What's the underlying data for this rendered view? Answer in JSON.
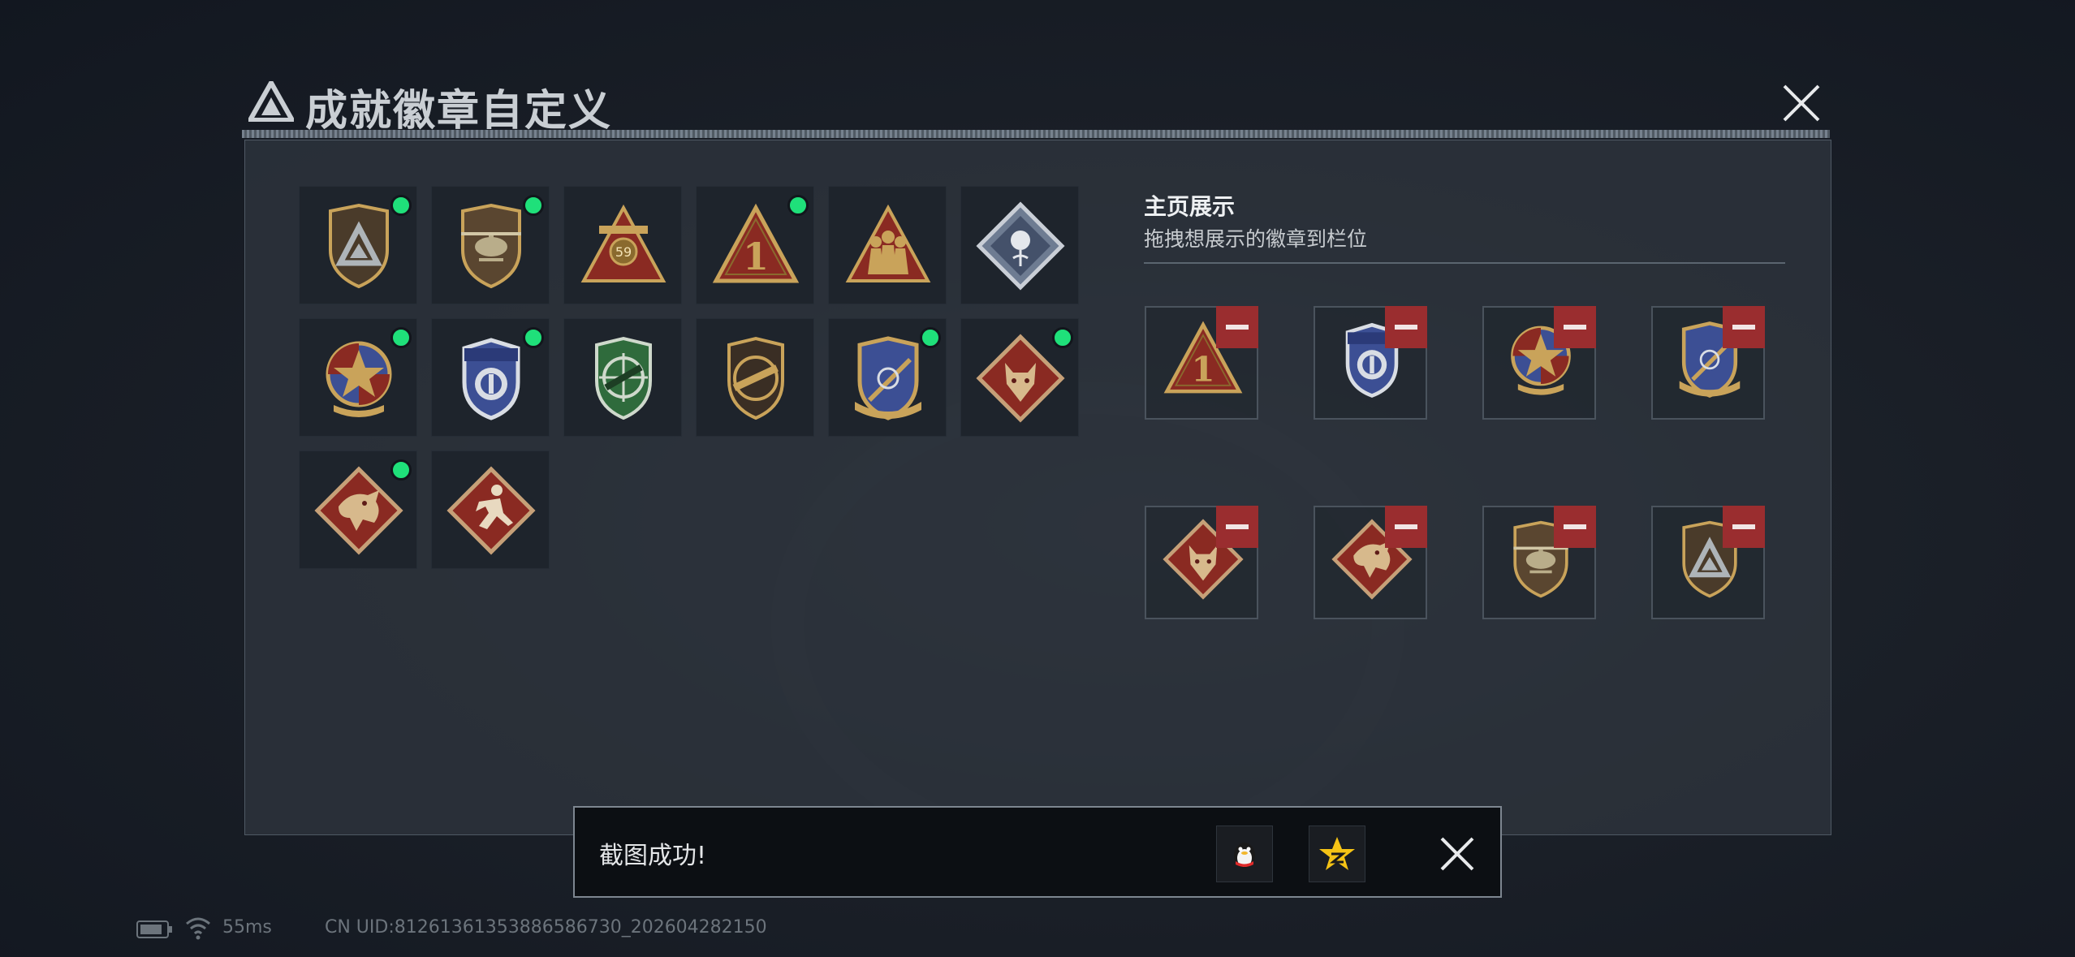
{
  "header": {
    "title": "成就徽章自定义",
    "tiny_text": "",
    "logo_icon": "triangle-logo-icon",
    "close_icon": "close-icon"
  },
  "badge_grid": [
    {
      "name": "triangle-shield-badge",
      "owned": true
    },
    {
      "name": "helicopter-shield-badge",
      "owned": true
    },
    {
      "name": "sniper-59-triangle-badge",
      "owned": false
    },
    {
      "name": "rank-1-triangle-badge",
      "owned": true
    },
    {
      "name": "soldiers-triangle-badge",
      "owned": false
    },
    {
      "name": "rose-diamond-badge",
      "owned": false
    },
    {
      "name": "star-medal-badge",
      "owned": true
    },
    {
      "name": "police-shield-badge",
      "owned": true
    },
    {
      "name": "crosshair-rifle-badge",
      "owned": false
    },
    {
      "name": "rifle-shield-badge",
      "owned": false
    },
    {
      "name": "rocket-shield-badge",
      "owned": true
    },
    {
      "name": "wolf-diamond-badge",
      "owned": true
    },
    {
      "name": "dragon-diamond-badge",
      "owned": true
    },
    {
      "name": "runner-diamond-badge",
      "owned": false
    }
  ],
  "showcase": {
    "title": "主页展示",
    "subtitle": "拖拽想展示的徽章到栏位",
    "slots": [
      "rank-1-triangle-badge",
      "police-shield-badge",
      "star-medal-badge",
      "rocket-shield-badge",
      "wolf-diamond-badge",
      "dragon-diamond-badge",
      "helicopter-shield-badge",
      "triangle-shield-badge"
    ]
  },
  "toast": {
    "message": "截图成功!",
    "share_icons": [
      "qq-penguin-icon",
      "qzone-star-icon"
    ],
    "close_icon": "close-icon"
  },
  "status_bar": {
    "battery_icon": "battery-icon",
    "wifi_icon": "wifi-icon",
    "ping": "55ms",
    "uid": "CN UID:81261361353886586730_202604282150"
  },
  "colors": {
    "owned_dot": "#1fe07a",
    "remove_button": "#9a2d2f",
    "panel_bg": "#2e343e",
    "badge_gold": "#c9a35a",
    "badge_red": "#8a2a22"
  }
}
